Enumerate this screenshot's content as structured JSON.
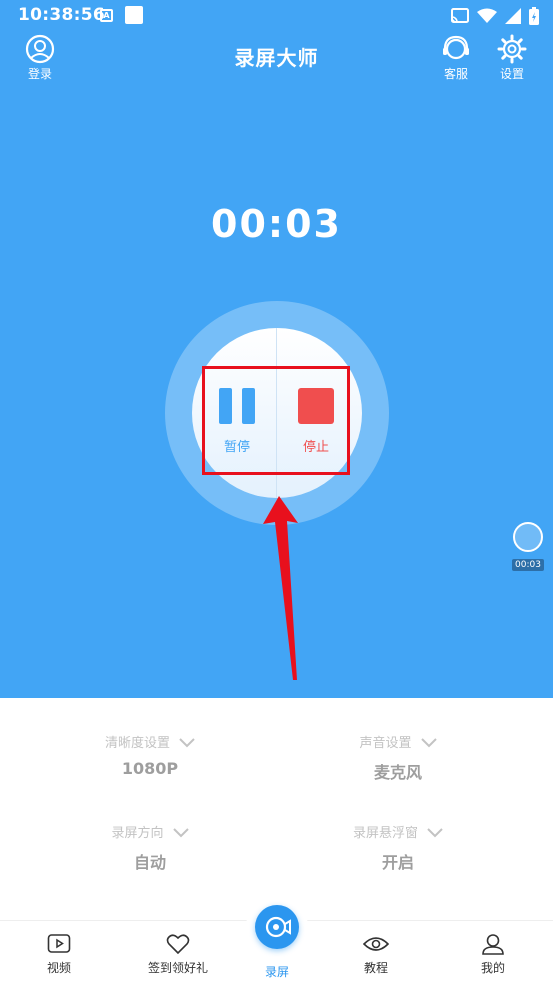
{
  "status_bar": {
    "time": "10:38:56",
    "a_badge": "A"
  },
  "header": {
    "title": "录屏大师",
    "login_label": "登录",
    "service_label": "客服",
    "settings_label": "设置"
  },
  "recording": {
    "timer": "00:03",
    "pause_label": "暂停",
    "stop_label": "停止"
  },
  "floating_widget": {
    "time": "00:03"
  },
  "settings": {
    "quality": {
      "label": "清晰度设置",
      "value": "1080P"
    },
    "audio": {
      "label": "声音设置",
      "value": "麦克风"
    },
    "orientation": {
      "label": "录屏方向",
      "value": "自动"
    },
    "floating_window": {
      "label": "录屏悬浮窗",
      "value": "开启"
    }
  },
  "bottom_nav": {
    "video": "视频",
    "checkin": "签到领好礼",
    "record": "录屏",
    "tutorial": "教程",
    "mine": "我的"
  },
  "colors": {
    "primary": "#42a5f5",
    "stop": "#f04e4e",
    "highlight": "#e8101d",
    "nav_active": "#2b96ef"
  }
}
